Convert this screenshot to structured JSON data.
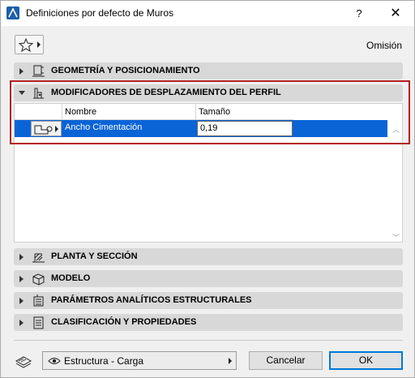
{
  "window": {
    "title": "Definiciones por defecto de Muros",
    "help_label": "?",
    "close_label": "✕"
  },
  "toolbar": {
    "favorites_icon": "star-icon",
    "omision_label": "Omisión"
  },
  "panels": [
    {
      "label": "GEOMETRÍA Y POSICIONAMIENTO",
      "icon": "geometry-icon",
      "expanded": false
    },
    {
      "label": "MODIFICADORES DE DESPLAZAMIENTO DEL PERFIL",
      "icon": "profile-modifier-icon",
      "expanded": true
    },
    {
      "label": "PLANTA Y SECCIÓN",
      "icon": "floor-plan-icon",
      "expanded": false
    },
    {
      "label": "MODELO",
      "icon": "model-icon",
      "expanded": false
    },
    {
      "label": "PARÁMETROS ANALÍTICOS ESTRUCTURALES",
      "icon": "structural-icon",
      "expanded": false
    },
    {
      "label": "CLASIFICACIÓN Y PROPIEDADES",
      "icon": "classification-icon",
      "expanded": false
    }
  ],
  "modifiers_table": {
    "columns": [
      "",
      "Nombre",
      "Tamaño"
    ],
    "rows": [
      {
        "name": "Ancho Cimentación",
        "size": "0,19",
        "selected": true
      }
    ]
  },
  "footer": {
    "layer_value": "Estructura - Carga",
    "cancel_label": "Cancelar",
    "ok_label": "OK"
  },
  "colors": {
    "selection": "#0a64d6",
    "highlight_border": "#b32020",
    "panel_header": "#d8d8d8"
  }
}
